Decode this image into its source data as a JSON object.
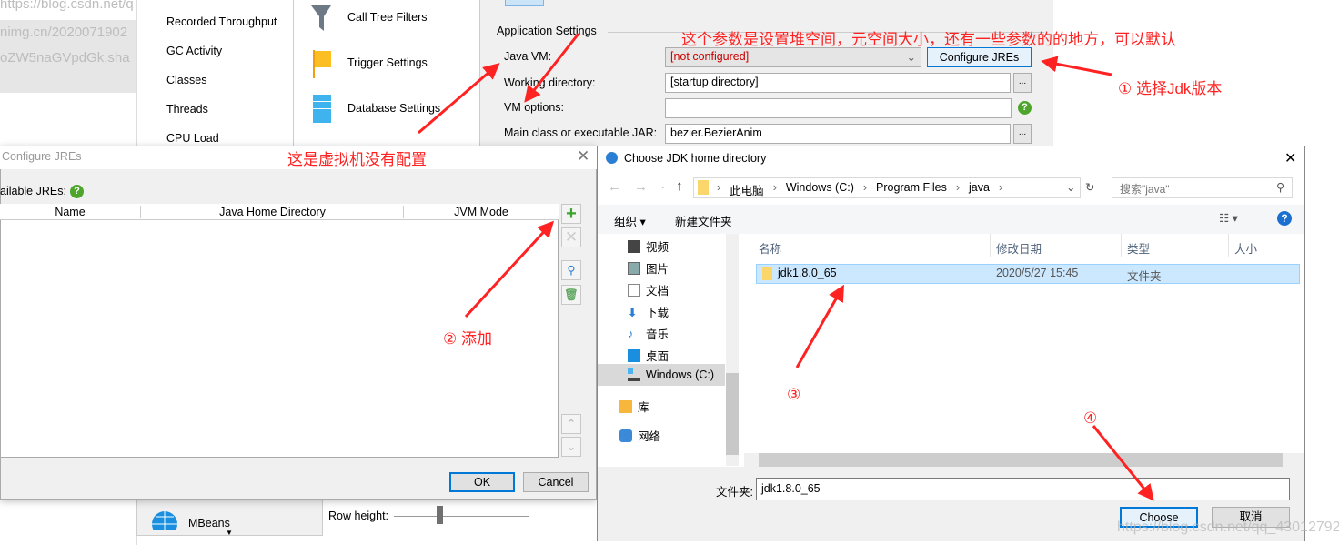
{
  "background_browser": {
    "url_fragment": "https://blog.csdn.net/q",
    "line1": "nimg.cn/2020071902",
    "line2": "oZW5naGVpdGk,sha"
  },
  "main_window": {
    "left_list": [
      "Recorded Throughput",
      "GC Activity",
      "Classes",
      "Threads",
      "CPU Load"
    ],
    "middle_list": [
      "Call Tree Filters",
      "Trigger Settings",
      "Database Settings"
    ],
    "section_title": "Application Settings",
    "java_vm_label": "Java VM:",
    "java_vm_value": "[not configured]",
    "configure_jres_label": "Configure JREs",
    "working_dir_label": "Working directory:",
    "working_dir_value": "[startup directory]",
    "vm_options_label": "VM options:",
    "vm_options_value": "",
    "main_class_label": "Main class or executable JAR:",
    "main_class_value": "bezier.BezierAnim",
    "browse_label": "...",
    "mbeans_label": "MBeans",
    "row_height_label": "Row height:",
    "row_height_level": 0.3
  },
  "configure_jres_dialog": {
    "title": "Configure JREs",
    "available_label": "ailable JREs:",
    "columns": [
      "Name",
      "Java Home Directory",
      "JVM Mode"
    ],
    "rows": [],
    "ok_label": "OK",
    "cancel_label": "Cancel"
  },
  "choose_jdk_dialog": {
    "title": "Choose JDK home directory",
    "breadcrumb": [
      "此电脑",
      "Windows (C:)",
      "Program Files",
      "java"
    ],
    "search_placeholder": "搜索\"java\"",
    "organize_label": "组织 ▾",
    "new_folder_label": "新建文件夹",
    "nav_items": [
      "视频",
      "图片",
      "文档",
      "下载",
      "音乐",
      "桌面",
      "Windows (C:)",
      "库",
      "网络"
    ],
    "columns": [
      "名称",
      "修改日期",
      "类型",
      "大小"
    ],
    "files": [
      {
        "name": "jdk1.8.0_65",
        "modified": "2020/5/27 15:45",
        "type": "文件夹",
        "size": ""
      }
    ],
    "folder_label": "文件夹:",
    "folder_value": "jdk1.8.0_65",
    "choose_label": "Choose",
    "cancel_label": "取消"
  },
  "annotations": {
    "vm_options_note": "这个参数是设置堆空间，元空间大小，还有一些参数的的地方，可以默认",
    "step1": "① 选择Jdk版本",
    "no_vm_note": "这是虚拟机没有配置",
    "step2": "② 添加",
    "step3": "③",
    "step4": "④",
    "color": "#ff2b2b"
  },
  "watermark": "https://blog.csdn.net/qq_43012792"
}
